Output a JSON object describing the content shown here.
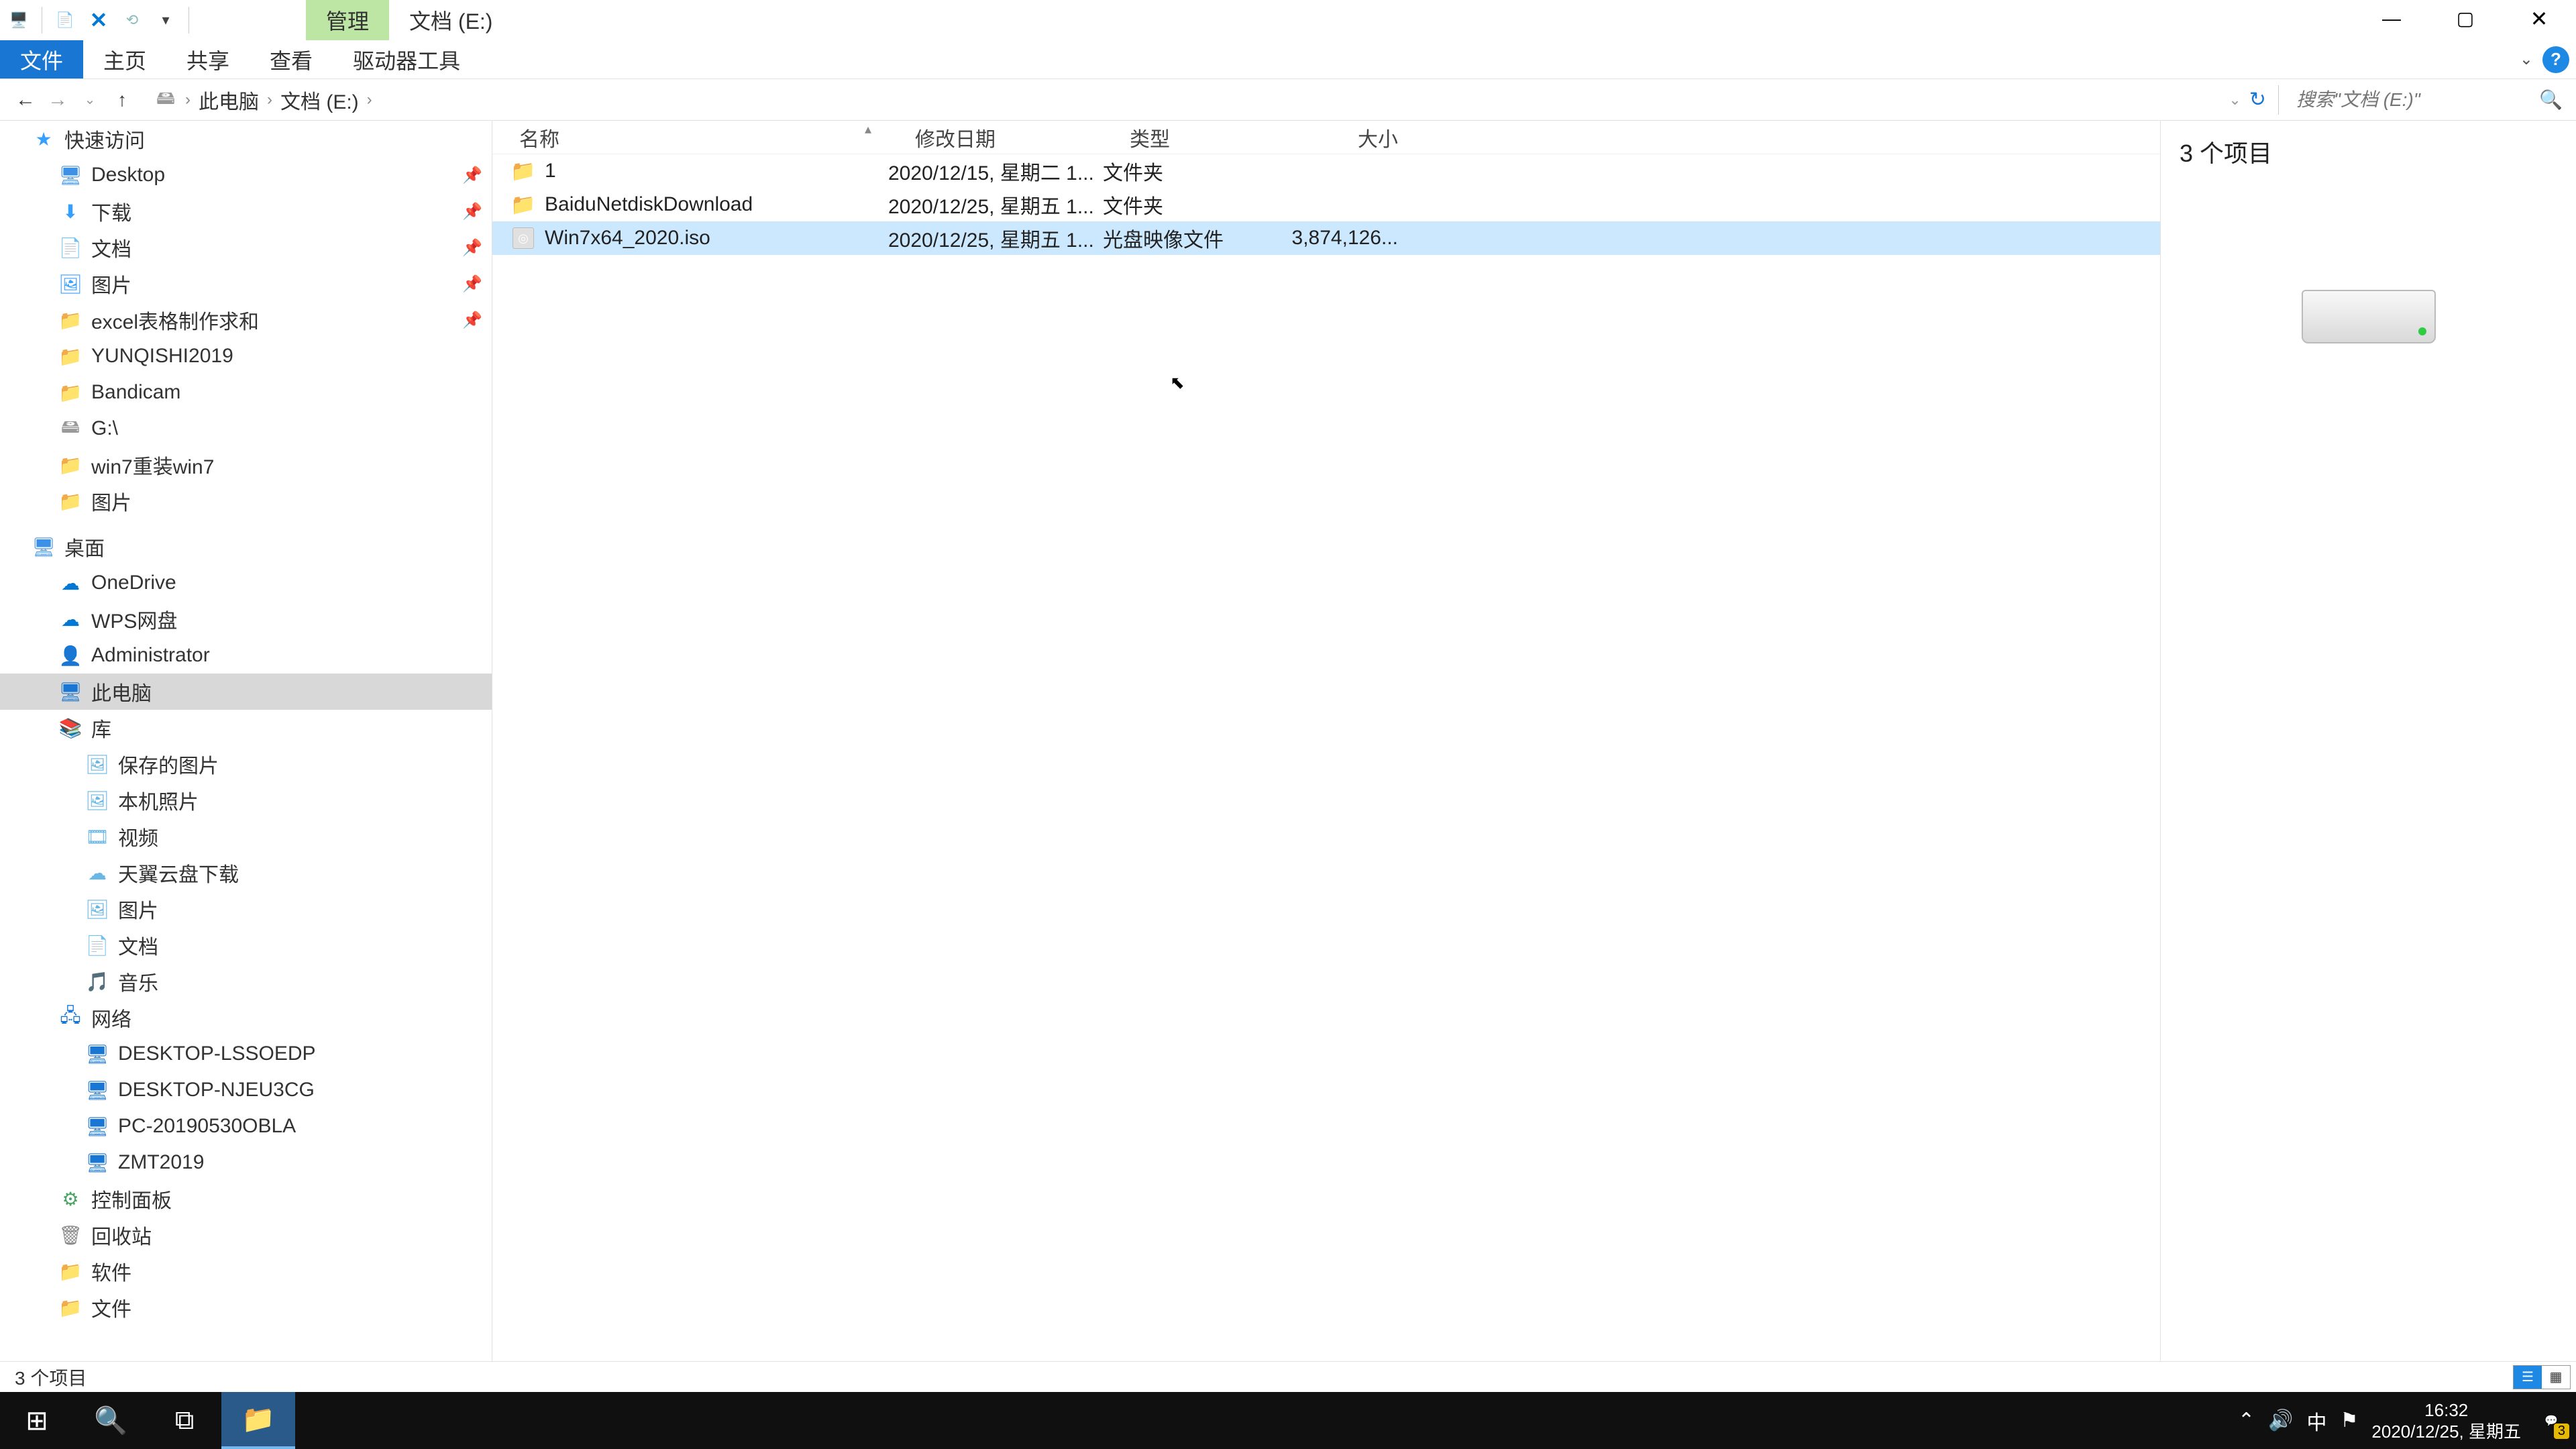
{
  "titlebar": {
    "contextual_tab": "管理",
    "title": "文档 (E:)"
  },
  "ribbon": {
    "file": "文件",
    "home": "主页",
    "share": "共享",
    "view": "查看",
    "drive_tools": "驱动器工具"
  },
  "breadcrumb": {
    "this_pc": "此电脑",
    "drive": "文档 (E:)"
  },
  "search": {
    "placeholder": "搜索\"文档 (E:)\""
  },
  "navtree": {
    "quick_access": "快速访问",
    "desktop": "Desktop",
    "downloads": "下载",
    "documents": "文档",
    "pictures": "图片",
    "excel_req": "excel表格制作求和",
    "yunqishi": "YUNQISHI2019",
    "bandicam": "Bandicam",
    "gdrive": "G:\\",
    "win7_reinst": "win7重装win7",
    "pictures2": "图片",
    "desktop_root": "桌面",
    "onedrive": "OneDrive",
    "wps": "WPS网盘",
    "administrator": "Administrator",
    "this_pc": "此电脑",
    "libraries": "库",
    "saved_pics": "保存的图片",
    "camera_roll": "本机照片",
    "videos": "视频",
    "tianyi": "天翼云盘下载",
    "pics3": "图片",
    "docs2": "文档",
    "music": "音乐",
    "network": "网络",
    "net1": "DESKTOP-LSSOEDP",
    "net2": "DESKTOP-NJEU3CG",
    "net3": "PC-20190530OBLA",
    "net4": "ZMT2019",
    "control_panel": "控制面板",
    "recycle": "回收站",
    "software": "软件",
    "file_folder": "文件"
  },
  "columns": {
    "name": "名称",
    "date": "修改日期",
    "type": "类型",
    "size": "大小"
  },
  "rows": [
    {
      "name": "1",
      "date": "2020/12/15, 星期二 1...",
      "type": "文件夹",
      "size": "",
      "icon": "folder",
      "selected": false
    },
    {
      "name": "BaiduNetdiskDownload",
      "date": "2020/12/25, 星期五 1...",
      "type": "文件夹",
      "size": "",
      "icon": "folder",
      "selected": false
    },
    {
      "name": "Win7x64_2020.iso",
      "date": "2020/12/25, 星期五 1...",
      "type": "光盘映像文件",
      "size": "3,874,126...",
      "icon": "iso",
      "selected": true
    }
  ],
  "preview": {
    "title": "3 个项目"
  },
  "status": {
    "text": "3 个项目"
  },
  "systray": {
    "ime": "中",
    "time": "16:32",
    "date": "2020/12/25, 星期五",
    "notif_count": "3"
  }
}
